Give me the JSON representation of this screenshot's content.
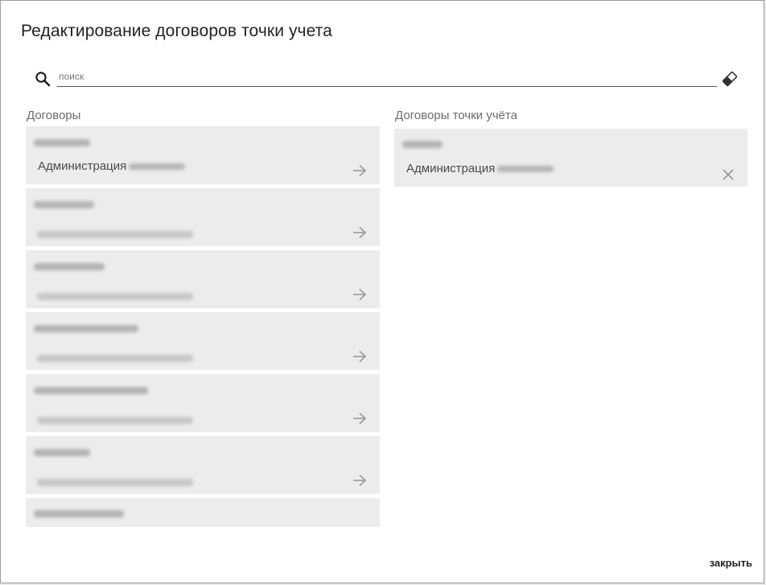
{
  "dialog": {
    "title": "Редактирование договоров точки учета",
    "close_label": "закрыть"
  },
  "search": {
    "placeholder": "поиск",
    "value": "",
    "icon": "search-icon",
    "clear_icon": "eraser-icon"
  },
  "contracts": {
    "title": "Договоры",
    "first_item_name": "Администрация",
    "action_icon": "arrow-right-icon"
  },
  "point_contracts": {
    "title": "Договоры точки учёта",
    "first_item_name": "Администрация",
    "action_icon": "close-icon"
  }
}
